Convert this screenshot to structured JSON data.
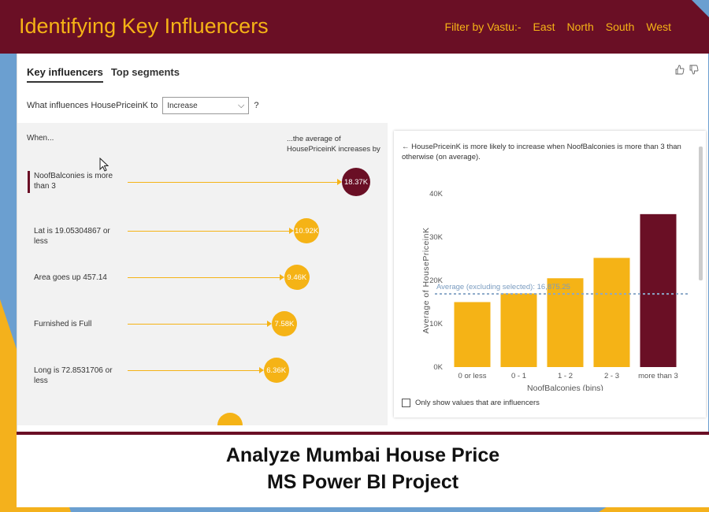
{
  "header": {
    "title": "Identifying Key Influencers",
    "filter_label": "Filter by Vastu:-",
    "filters": [
      "East",
      "North",
      "South",
      "West"
    ]
  },
  "tabs": [
    {
      "label": "Key influencers",
      "active": true
    },
    {
      "label": "Top segments",
      "active": false
    }
  ],
  "question": {
    "prefix": "What influences HousePriceinK to",
    "selected": "Increase",
    "help": "?"
  },
  "influencers_panel": {
    "when_label": "When...",
    "avg_label": "...the average of HousePriceinK increases by",
    "items": [
      {
        "text": "NoofBalconies is more than 3",
        "value": "18.37K",
        "value_num": 18.37,
        "selected": true
      },
      {
        "text": "Lat is 19.05304867 or less",
        "value": "10.92K",
        "value_num": 10.92,
        "selected": false
      },
      {
        "text": "Area goes up 457.14",
        "value": "9.46K",
        "value_num": 9.46,
        "selected": false
      },
      {
        "text": "Furnished is Full",
        "value": "7.58K",
        "value_num": 7.58,
        "selected": false
      },
      {
        "text": "Long is 72.8531706 or less",
        "value": "6.36K",
        "value_num": 6.36,
        "selected": false
      }
    ]
  },
  "detail_card": {
    "back_arrow": "←",
    "title": "HousePriceinK is more likely to increase when NoofBalconies is more than 3 than otherwise (on average).",
    "checkbox_label": "Only show values that are influencers",
    "checkbox_checked": false
  },
  "chart_data": {
    "type": "bar",
    "categories": [
      "0 or less",
      "0 - 1",
      "1 - 2",
      "2 - 3",
      "more than 3"
    ],
    "values": [
      15000,
      17000,
      20500,
      25200,
      35300
    ],
    "highlighted": "more than 3",
    "xlabel": "NoofBalconies (bins)",
    "ylabel": "Average of HousePriceinK",
    "ylim": [
      0,
      40000
    ],
    "yticks": [
      0,
      10000,
      20000,
      30000,
      40000
    ],
    "ytick_labels": [
      "0K",
      "10K",
      "20K",
      "30K",
      "40K"
    ],
    "average_line": {
      "label": "Average (excluding selected): 16,875.25",
      "value": 16875.25
    },
    "colors": {
      "normal": "#f5b316",
      "highlight": "#6a0f25",
      "avg": "#8aa8c8"
    }
  },
  "footer": {
    "line1": "Analyze Mumbai House Price",
    "line2": "MS Power BI Project"
  }
}
